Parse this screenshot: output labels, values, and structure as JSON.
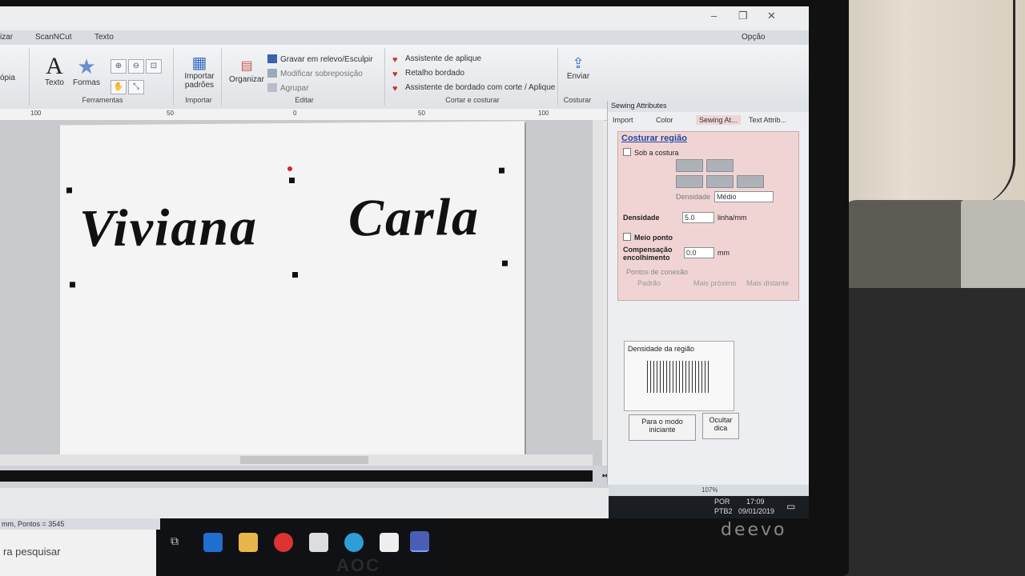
{
  "titlebar": {
    "minimize": "–",
    "restore": "❐",
    "close": "✕"
  },
  "tabs": [
    {
      "label": "izar"
    },
    {
      "label": "ScanNCut"
    },
    {
      "label": "Texto"
    }
  ],
  "option_label": "Opção",
  "ribbon": {
    "copy_label": "ópia",
    "text_label": "Texto",
    "shapes_label": "Formas",
    "tools_group": "Ferramentas",
    "import_patterns": "Importar padrões",
    "import_group": "Importar",
    "organize": "Organizar",
    "emboss": "Gravar em relevo/Esculpir",
    "modify_overlap": "Modificar sobreposição",
    "group": "Agrupar",
    "edit_group": "Editar",
    "applique_wizard": "Assistente de aplique",
    "embroidered_patch": "Retalho bordado",
    "cut_wizard": "Assistente de bordado com corte / Aplique",
    "cut_sew_group": "Cortar e costurar",
    "send": "Enviar",
    "sew_group": "Costurar"
  },
  "ruler": [
    "100",
    "50",
    "0",
    "50",
    "100"
  ],
  "design": {
    "word1": "Viviana",
    "word2": "Carla"
  },
  "sewing_panel": {
    "title": "Sewing Attributes",
    "tabs": [
      "Import",
      "Color",
      "Sewing At...",
      "Text Attrib..."
    ],
    "section_title": "Costurar região",
    "under_sewing": "Sob a costura",
    "density_small_label": "Densidade",
    "density_select": "Médio",
    "density_label": "Densidade",
    "density_value": "5.0",
    "density_unit": "linha/mm",
    "half_stitch": "Meio ponto",
    "pull_comp_label": "Compensação encolhimento",
    "pull_comp_value": "0.0",
    "pull_comp_unit": "mm",
    "connection_points": "Pontos de conexão",
    "opt_standard": "Padrão",
    "opt_nearest": "Mais próximo",
    "opt_farthest": "Mais distante",
    "region_density": "Densidade da região",
    "beginner_mode": "Para o modo iniciante",
    "hide_tip": "Ocultar dica"
  },
  "status": {
    "zoom": "107%",
    "points": "mm, Pontos = 3545"
  },
  "taskbar": {
    "lang": "POR",
    "layout": "PTB2",
    "time": "17:09",
    "date": "09/01/2019",
    "search": "ra pesquisar"
  },
  "brand": "deevo",
  "aoc": "AOC"
}
